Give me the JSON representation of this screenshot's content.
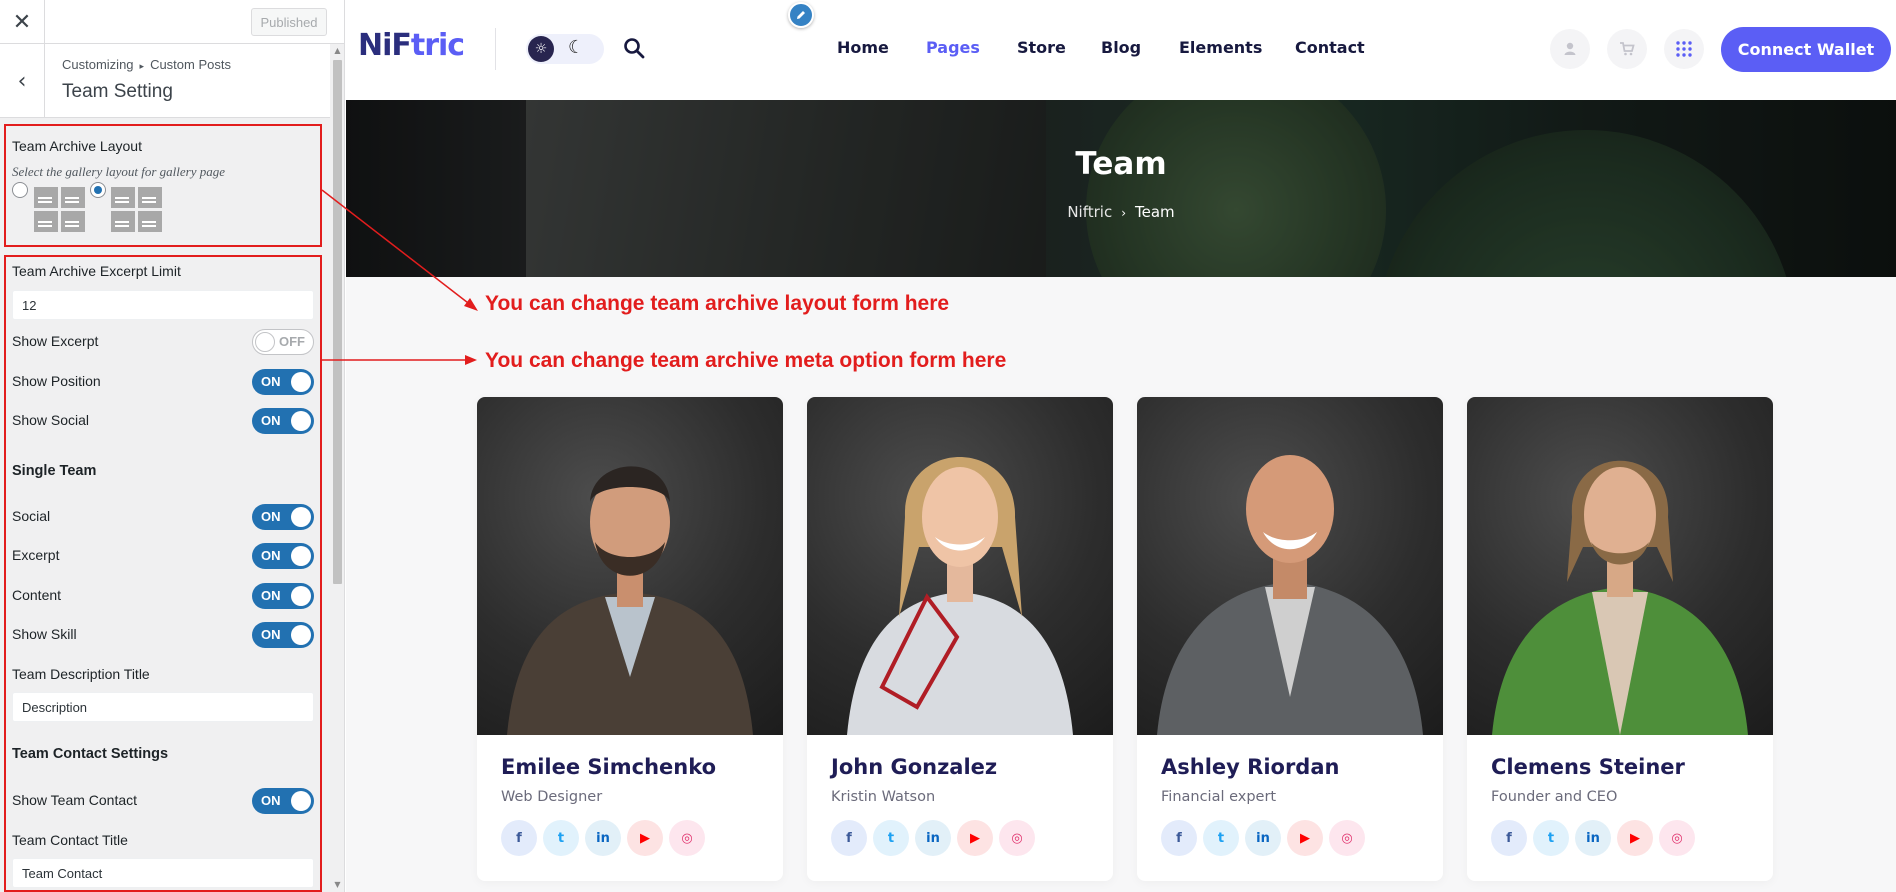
{
  "customizer": {
    "close_label": "✕",
    "published_label": "Published",
    "back_label": "‹",
    "breadcrumb_root": "Customizing",
    "breadcrumb_separator": "▸",
    "breadcrumb_section": "Custom Posts",
    "title": "Team Setting",
    "archive_layout": {
      "label": "Team Archive Layout",
      "description": "Select the gallery layout for gallery page",
      "options": [
        {
          "checked": false
        },
        {
          "checked": true
        }
      ]
    },
    "excerpt_limit": {
      "label": "Team Archive Excerpt Limit",
      "value": "12"
    },
    "show_excerpt": {
      "label": "Show Excerpt",
      "state": "OFF"
    },
    "show_position": {
      "label": "Show Position",
      "state": "ON"
    },
    "show_social": {
      "label": "Show Social",
      "state": "ON"
    },
    "single_team_heading": "Single Team",
    "social": {
      "label": "Social",
      "state": "ON"
    },
    "excerpt": {
      "label": "Excerpt",
      "state": "ON"
    },
    "content": {
      "label": "Content",
      "state": "ON"
    },
    "show_skill": {
      "label": "Show Skill",
      "state": "ON"
    },
    "description_title": {
      "label": "Team Description Title",
      "value": "Description"
    },
    "contact_heading": "Team Contact Settings",
    "show_team_contact": {
      "label": "Show Team Contact",
      "state": "ON"
    },
    "contact_title": {
      "label": "Team Contact Title",
      "value": "Team Contact"
    }
  },
  "site": {
    "logo_part1": "NiF",
    "logo_part2": "tric",
    "nav": [
      "Home",
      "Pages",
      "Store",
      "Blog",
      "Elements",
      "Contact"
    ],
    "active_nav": "Pages",
    "connect_wallet": "Connect Wallet",
    "banner_title": "Team",
    "breadcrumb_home": "Niftric",
    "breadcrumb_arrow": "›",
    "breadcrumb_current": "Team"
  },
  "annotations": {
    "layout_note": "You can change team archive layout form here",
    "meta_note": "You can change team archive meta option form here"
  },
  "team": [
    {
      "name": "Emilee Simchenko",
      "role": "Web Designer"
    },
    {
      "name": "John Gonzalez",
      "role": "Kristin Watson"
    },
    {
      "name": "Ashley Riordan",
      "role": "Financial expert"
    },
    {
      "name": "Clemens Steiner",
      "role": "Founder and CEO"
    }
  ],
  "social_icons": {
    "facebook": "f",
    "twitter": "t",
    "linkedin": "in",
    "youtube": "▶",
    "instagram": "◎"
  },
  "colors": {
    "accent": "#5b5ef5",
    "brand_dark": "#1f1d56",
    "toggle_on": "#2271b1",
    "annotation_red": "#e21d1d"
  }
}
